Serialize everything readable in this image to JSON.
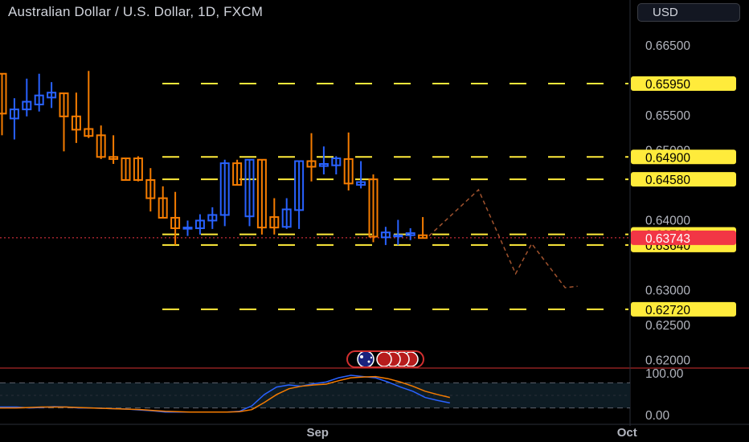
{
  "header": {
    "title": "Australian Dollar / U.S. Dollar, 1D, FXCM",
    "currency": "USD"
  },
  "colors": {
    "background": "#000000",
    "bull": "#2962ff",
    "bear": "#f57c00",
    "levels": "#ffeb3b",
    "current_price": "#f23645",
    "stoch_k": "#2962ff",
    "stoch_d": "#f57c00"
  },
  "chart_data": {
    "type": "candlestick",
    "symbol": "AUDUSD",
    "interval": "1D",
    "y_range": [
      0.6188,
      0.668
    ],
    "y_ticks": [
      "0.66500",
      "0.65500",
      "0.65000",
      "0.64000",
      "0.63000",
      "0.62500",
      "0.62000"
    ],
    "x_ticks": [
      {
        "label": "Sep",
        "bar_index": 25.5
      },
      {
        "label": "Oct",
        "bar_index": 50.5
      }
    ],
    "candles": [
      {
        "o": 0.6609,
        "h": 0.6609,
        "l": 0.6521,
        "c": 0.6552
      },
      {
        "o": 0.6545,
        "h": 0.6574,
        "l": 0.6515,
        "c": 0.6558
      },
      {
        "o": 0.6558,
        "h": 0.6602,
        "l": 0.6548,
        "c": 0.6569
      },
      {
        "o": 0.6565,
        "h": 0.6609,
        "l": 0.6555,
        "c": 0.6578
      },
      {
        "o": 0.6575,
        "h": 0.6597,
        "l": 0.656,
        "c": 0.6582
      },
      {
        "o": 0.6581,
        "h": 0.6581,
        "l": 0.6498,
        "c": 0.6548
      },
      {
        "o": 0.6548,
        "h": 0.6582,
        "l": 0.651,
        "c": 0.6529
      },
      {
        "o": 0.653,
        "h": 0.6613,
        "l": 0.6517,
        "c": 0.652
      },
      {
        "o": 0.6521,
        "h": 0.6535,
        "l": 0.6487,
        "c": 0.649
      },
      {
        "o": 0.649,
        "h": 0.6521,
        "l": 0.648,
        "c": 0.6487
      },
      {
        "o": 0.6488,
        "h": 0.6488,
        "l": 0.6457,
        "c": 0.6457
      },
      {
        "o": 0.6488,
        "h": 0.6491,
        "l": 0.6455,
        "c": 0.6457
      },
      {
        "o": 0.6457,
        "h": 0.6474,
        "l": 0.6412,
        "c": 0.6431
      },
      {
        "o": 0.6431,
        "h": 0.6448,
        "l": 0.6403,
        "c": 0.6403
      },
      {
        "o": 0.6403,
        "h": 0.644,
        "l": 0.6364,
        "c": 0.6388
      },
      {
        "o": 0.6388,
        "h": 0.6399,
        "l": 0.6377,
        "c": 0.6389
      },
      {
        "o": 0.6388,
        "h": 0.6408,
        "l": 0.6379,
        "c": 0.6399
      },
      {
        "o": 0.6399,
        "h": 0.6418,
        "l": 0.6387,
        "c": 0.6407
      },
      {
        "o": 0.6407,
        "h": 0.6486,
        "l": 0.6391,
        "c": 0.6481
      },
      {
        "o": 0.6481,
        "h": 0.6486,
        "l": 0.645,
        "c": 0.645
      },
      {
        "o": 0.6405,
        "h": 0.6486,
        "l": 0.6391,
        "c": 0.6486
      },
      {
        "o": 0.6486,
        "h": 0.6486,
        "l": 0.6379,
        "c": 0.6389
      },
      {
        "o": 0.6404,
        "h": 0.6431,
        "l": 0.6379,
        "c": 0.6389
      },
      {
        "o": 0.639,
        "h": 0.6431,
        "l": 0.6387,
        "c": 0.6415
      },
      {
        "o": 0.6414,
        "h": 0.6484,
        "l": 0.6387,
        "c": 0.6484
      },
      {
        "o": 0.6484,
        "h": 0.6524,
        "l": 0.6455,
        "c": 0.6476
      },
      {
        "o": 0.6477,
        "h": 0.6505,
        "l": 0.6465,
        "c": 0.648
      },
      {
        "o": 0.6478,
        "h": 0.6491,
        "l": 0.6465,
        "c": 0.6488
      },
      {
        "o": 0.6487,
        "h": 0.6525,
        "l": 0.6442,
        "c": 0.6452
      },
      {
        "o": 0.645,
        "h": 0.6484,
        "l": 0.6445,
        "c": 0.6454
      },
      {
        "o": 0.6458,
        "h": 0.6465,
        "l": 0.6368,
        "c": 0.6376
      },
      {
        "o": 0.6375,
        "h": 0.639,
        "l": 0.6364,
        "c": 0.6382
      },
      {
        "o": 0.6377,
        "h": 0.64,
        "l": 0.6364,
        "c": 0.6378
      },
      {
        "o": 0.6378,
        "h": 0.6388,
        "l": 0.6371,
        "c": 0.6381
      },
      {
        "o": 0.6378,
        "h": 0.6404,
        "l": 0.6374,
        "c": 0.6374
      }
    ],
    "levels": [
      {
        "price": 0.6595,
        "label": "0.65950"
      },
      {
        "price": 0.649,
        "label": "0.64900"
      },
      {
        "price": 0.6458,
        "label": "0.64580"
      },
      {
        "price": 0.63792,
        "label": "0.63792"
      },
      {
        "price": 0.6364,
        "label": "0.63640"
      },
      {
        "price": 0.6272,
        "label": "0.62720"
      }
    ],
    "current_price": {
      "price": 0.63743,
      "label": "0.63743"
    },
    "projection": [
      {
        "bar": 34.5,
        "price": 0.6377
      },
      {
        "bar": 38.5,
        "price": 0.6443
      },
      {
        "bar": 41.5,
        "price": 0.6323
      },
      {
        "bar": 42.8,
        "price": 0.6366
      },
      {
        "bar": 45.5,
        "price": 0.6303
      },
      {
        "bar": 46.5,
        "price": 0.6305
      }
    ],
    "oscillator": {
      "range": [
        0,
        100
      ],
      "ticks": [
        "100.00",
        "0.00"
      ],
      "bands": [
        80,
        20
      ],
      "k": [
        22,
        22,
        22,
        20,
        21,
        23,
        22,
        20,
        20,
        19,
        18,
        17,
        15,
        13,
        10,
        10,
        10,
        10,
        10,
        10,
        12,
        25,
        52,
        70,
        75,
        72,
        78,
        82,
        92,
        98,
        95,
        92,
        82,
        70,
        60,
        45,
        38,
        32
      ],
      "d": [
        20,
        20,
        20,
        21,
        22,
        22,
        22,
        21,
        20,
        19,
        18,
        17,
        16,
        14,
        12,
        11,
        10,
        10,
        10,
        10,
        11,
        16,
        33,
        52,
        66,
        72,
        75,
        77,
        85,
        92,
        94,
        95,
        90,
        82,
        72,
        60,
        52,
        45
      ]
    }
  },
  "event_badge": {
    "icon": "australia-flag-icon",
    "count_hint": "upcoming events"
  }
}
